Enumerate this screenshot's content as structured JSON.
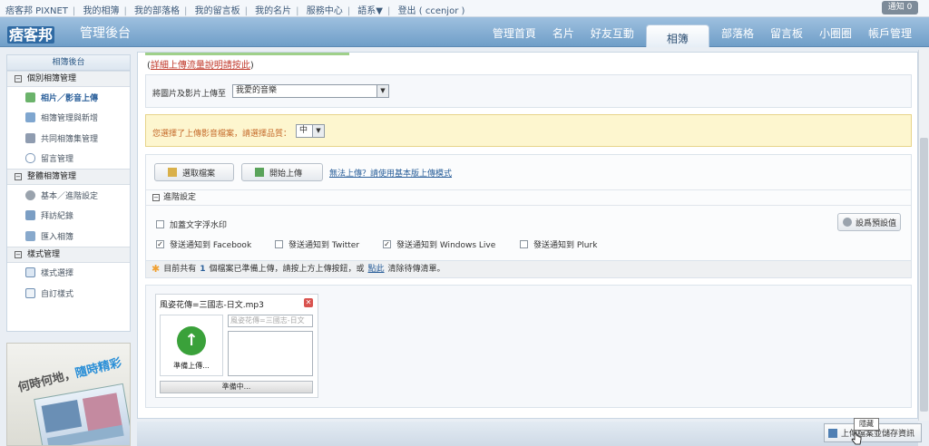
{
  "topbar": {
    "links": [
      "痞客邦 PIXNET",
      "我的相簿",
      "我的部落格",
      "我的留言板",
      "我的名片",
      "服務中心",
      "語系▼",
      "登出 ( ccenjor )"
    ],
    "notify": "通知 0"
  },
  "header": {
    "logo": "痞客邦",
    "title": "管理後台",
    "nav": [
      "管理首頁",
      "名片",
      "好友互動",
      "相簿",
      "部落格",
      "留言板",
      "小圈圈",
      "帳戶管理"
    ],
    "active_nav": "相簿"
  },
  "sidebar": {
    "title": "相簿後台",
    "sections": [
      {
        "label": "個別相簿管理",
        "items": [
          "相片／影音上傳",
          "相簿管理與新增",
          "共同相簿集管理",
          "留言管理"
        ]
      },
      {
        "label": "整體相簿管理",
        "items": [
          "基本／進階設定",
          "拜訪紀錄",
          "匯入相簿"
        ]
      },
      {
        "label": "樣式管理",
        "items": [
          "樣式選擇",
          "自訂樣式"
        ]
      }
    ],
    "promo_text_1": "何時何地，",
    "promo_text_2": "隨時精彩"
  },
  "main": {
    "help_prefix": "(",
    "help_link": "詳細上傳流量說明請按此",
    "help_suffix": ")",
    "target_label": "將圖片及影片上傳至",
    "target_value": "我愛的音樂",
    "quality_label": "您選擇了上傳影音檔案，請選擇品質：",
    "quality_value": "中",
    "select_files": "選取檔案",
    "start_upload": "開始上傳",
    "basic_link": "無法上傳？請使用基本版上傳模式",
    "advanced_label": "進階設定",
    "options": {
      "watermark": "加蓋文字浮水印",
      "facebook": "發送通知到 Facebook",
      "twitter": "發送通知到 Twitter",
      "windows_live": "發送通知到 Windows Live",
      "plurk": "發送通知到 Plurk"
    },
    "checked": {
      "watermark": false,
      "facebook": true,
      "twitter": false,
      "windows_live": true,
      "plurk": false
    },
    "set_default": "設爲預設值",
    "status": {
      "prefix": "目前共有",
      "count": "1",
      "middle": "個檔案已準備上傳，請按上方上傳按鈕，或",
      "link": "點此",
      "suffix": "清除待傳清單。"
    },
    "file": {
      "name": "風姿花傳=三國志-日文.mp3",
      "close": "✕",
      "thumb_label": "準備上傳...",
      "title_placeholder": "風姿花傳=三國志-日文",
      "progress": "準備中..."
    }
  },
  "bottom": {
    "save_button": "上傳檔案並儲存資訊",
    "tooltip": "隱藏"
  }
}
